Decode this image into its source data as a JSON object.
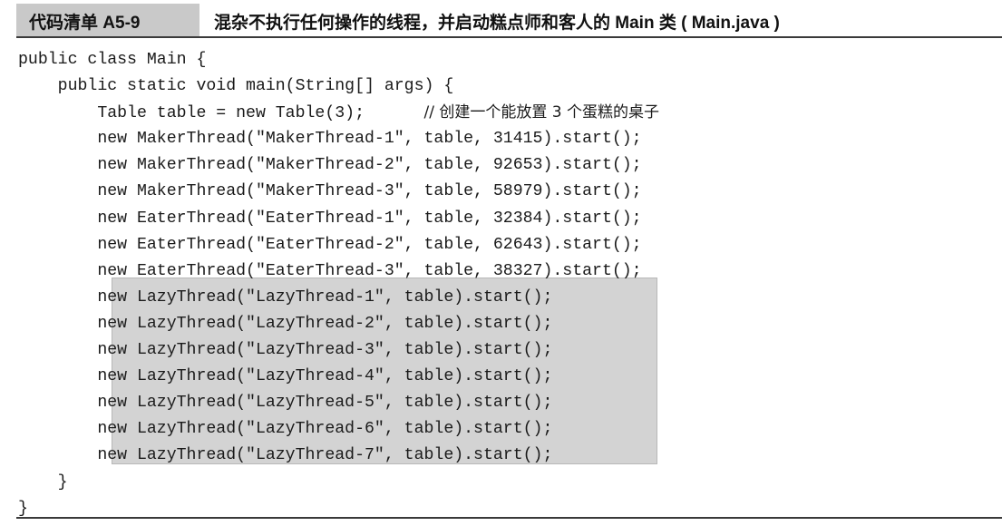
{
  "header": {
    "label": "代码清单 A5-9",
    "caption": "混杂不执行任何操作的线程，并启动糕点师和客人的 Main 类 ( Main.java )"
  },
  "code": {
    "lines": [
      {
        "text": "public class Main {",
        "comment": ""
      },
      {
        "text": "    public static void main(String[] args) {",
        "comment": ""
      },
      {
        "text": "        Table table = new Table(3);      ",
        "comment": "// 创建一个能放置 3 个蛋糕的桌子"
      },
      {
        "text": "        new MakerThread(\"MakerThread-1\", table, 31415).start();",
        "comment": ""
      },
      {
        "text": "        new MakerThread(\"MakerThread-2\", table, 92653).start();",
        "comment": ""
      },
      {
        "text": "        new MakerThread(\"MakerThread-3\", table, 58979).start();",
        "comment": ""
      },
      {
        "text": "        new EaterThread(\"EaterThread-1\", table, 32384).start();",
        "comment": ""
      },
      {
        "text": "        new EaterThread(\"EaterThread-2\", table, 62643).start();",
        "comment": ""
      },
      {
        "text": "        new EaterThread(\"EaterThread-3\", table, 38327).start();",
        "comment": ""
      },
      {
        "text": "        new LazyThread(\"LazyThread-1\", table).start();",
        "comment": ""
      },
      {
        "text": "        new LazyThread(\"LazyThread-2\", table).start();",
        "comment": ""
      },
      {
        "text": "        new LazyThread(\"LazyThread-3\", table).start();",
        "comment": ""
      },
      {
        "text": "        new LazyThread(\"LazyThread-4\", table).start();",
        "comment": ""
      },
      {
        "text": "        new LazyThread(\"LazyThread-5\", table).start();",
        "comment": ""
      },
      {
        "text": "        new LazyThread(\"LazyThread-6\", table).start();",
        "comment": ""
      },
      {
        "text": "        new LazyThread(\"LazyThread-7\", table).start();",
        "comment": ""
      },
      {
        "text": "    }",
        "comment": ""
      },
      {
        "text": "}",
        "comment": ""
      }
    ]
  }
}
